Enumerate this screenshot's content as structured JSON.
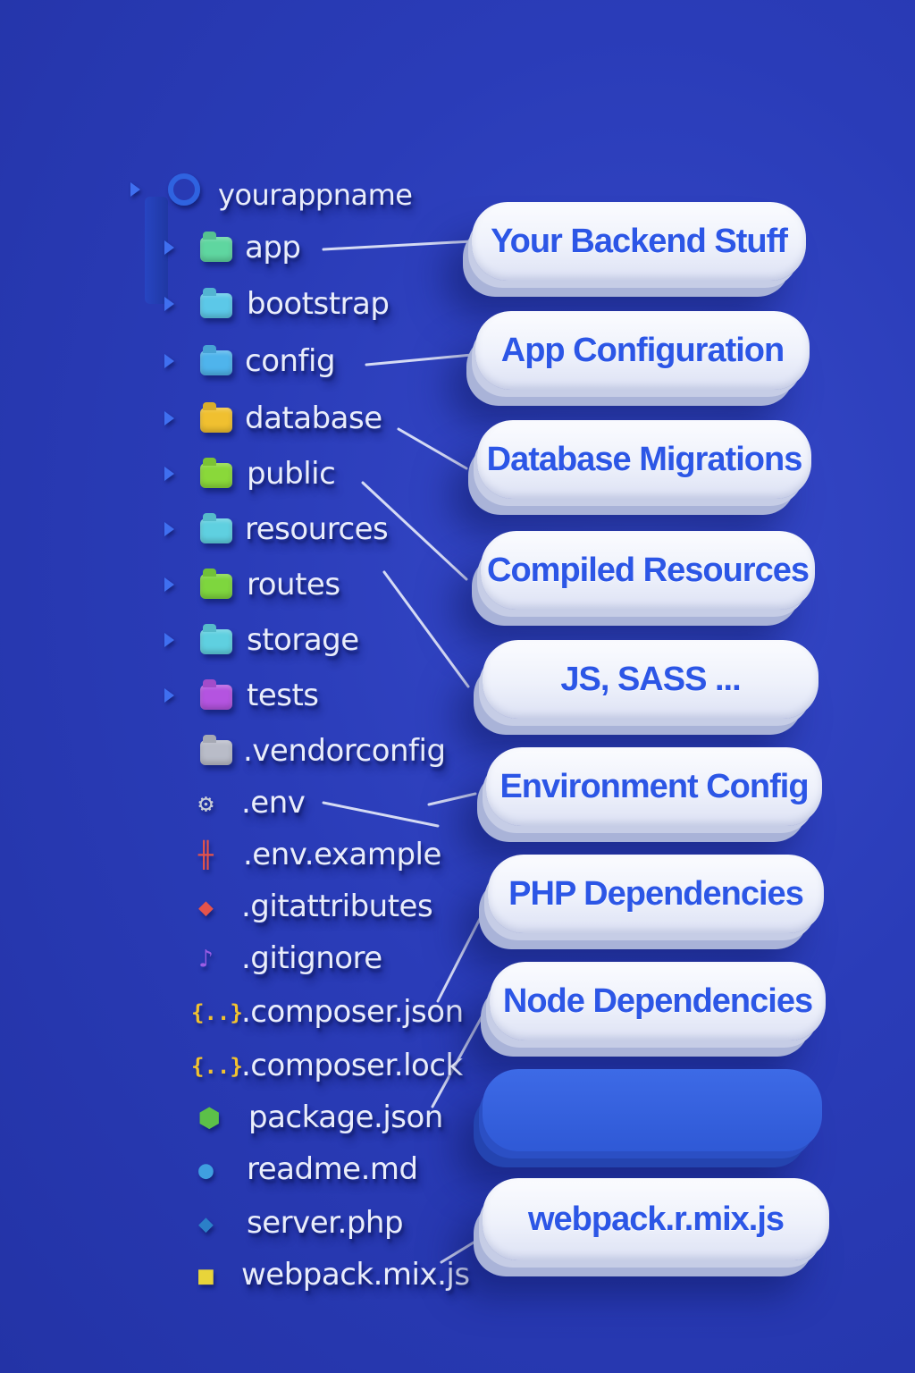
{
  "colors": {
    "background": "#2a3cb8",
    "accent": "#2c56e6",
    "pill": "#f2f4fc",
    "pill_blank": "#3461de",
    "label_text": "#e9edfb"
  },
  "tree": {
    "root": {
      "label": "yourappname",
      "icon": "circle-icon"
    },
    "folders": [
      {
        "label": "app",
        "icon": "folder-icon",
        "color": "#5fd6a0"
      },
      {
        "label": "bootstrap",
        "icon": "folder-icon",
        "color": "#5cc8e8"
      },
      {
        "label": "config",
        "icon": "folder-gear-icon",
        "color": "#4fb4ec"
      },
      {
        "label": "database",
        "icon": "folder-database-icon",
        "color": "#f0c030"
      },
      {
        "label": "public",
        "icon": "folder-icon",
        "color": "#8ad83a"
      },
      {
        "label": "resources",
        "icon": "folder-icon",
        "color": "#5fd0e0"
      },
      {
        "label": "routes",
        "icon": "folder-icon",
        "color": "#7ed63e"
      },
      {
        "label": "storage",
        "icon": "folder-icon",
        "color": "#5fd0e0"
      },
      {
        "label": "tests",
        "icon": "folder-icon",
        "color": "#b454e0"
      },
      {
        "label": ".vendorconfig",
        "icon": "folder-icon",
        "color": "#b9bcc8"
      }
    ],
    "files": [
      {
        "label": ".env",
        "icon": "gear-icon",
        "glyph": "⚙",
        "color": "#c8ccd8"
      },
      {
        "label": ".env.example",
        "icon": "sliders-icon",
        "glyph": "╫",
        "color": "#e5534b"
      },
      {
        "label": ".gitattributes",
        "icon": "git-icon",
        "glyph": "◆",
        "color": "#e5534b"
      },
      {
        "label": ".gitignore",
        "icon": "gitignore-icon",
        "glyph": "♪",
        "color": "#9b5de5"
      },
      {
        "label": ".composer.json",
        "icon": "braces-icon",
        "glyph": "{..}",
        "color": "#f2c230"
      },
      {
        "label": ".composer.lock",
        "icon": "braces-icon",
        "glyph": "{..}",
        "color": "#f2c230"
      },
      {
        "label": "package.json",
        "icon": "node-icon",
        "glyph": "⬢",
        "color": "#5cc048"
      },
      {
        "label": "readme.md",
        "icon": "info-icon",
        "glyph": "●",
        "color": "#3f9fe0"
      },
      {
        "label": "server.php",
        "icon": "php-icon",
        "glyph": "◆",
        "color": "#2b80c8"
      },
      {
        "label": "webpack.mix.js",
        "icon": "js-icon",
        "glyph": "■",
        "color": "#e8d43a"
      }
    ]
  },
  "pills": [
    {
      "text": "Your Backend Stuff"
    },
    {
      "text": "App Configuration"
    },
    {
      "text": "Database Migrations"
    },
    {
      "text": "Compiled Resources"
    },
    {
      "text": "JS, SASS ..."
    },
    {
      "text": "Environment Config"
    },
    {
      "text": "PHP Dependencies"
    },
    {
      "text": "Node Dependencies"
    },
    {
      "text": ""
    },
    {
      "text": "webpack.r.mix.js"
    }
  ]
}
